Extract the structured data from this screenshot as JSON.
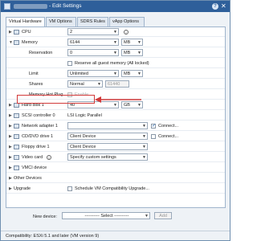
{
  "window": {
    "title": "- Edit Settings"
  },
  "tabs": [
    {
      "label": "Virtual Hardware"
    },
    {
      "label": "VM Options"
    },
    {
      "label": "SDRS Rules"
    },
    {
      "label": "vApp Options"
    }
  ],
  "rows": {
    "cpu": {
      "label": "CPU",
      "value": "2"
    },
    "memory": {
      "label": "Memory",
      "value": "6144",
      "unit": "MB"
    },
    "reservation": {
      "label": "Reservation",
      "value": "0",
      "unit": "MB"
    },
    "reserve_all": {
      "label": "Reserve all guest memory (All locked)"
    },
    "limit": {
      "label": "Limit",
      "value": "Unlimited",
      "unit": "MB"
    },
    "shares": {
      "label": "Shares",
      "value": "Normal",
      "extra": "61440"
    },
    "hotplug": {
      "label": "Memory Hot Plug",
      "checkbox_label": "Enable"
    },
    "hard_disk": {
      "label": "Hard disk 1",
      "value": "40",
      "unit": "GB"
    },
    "scsi": {
      "label": "SCSI controller 0",
      "value": "LSI Logic Parallel"
    },
    "network": {
      "label": "Network adapter 1",
      "connect": "Connect..."
    },
    "cd": {
      "label": "CD/DVD drive 1",
      "value": "Client Device",
      "connect": "Connect..."
    },
    "floppy": {
      "label": "Floppy drive 1",
      "value": "Client Device"
    },
    "video": {
      "label": "Video card",
      "value": "Specify custom settings"
    },
    "vmci": {
      "label": "VMCI device"
    },
    "other": {
      "label": "Other Devices"
    },
    "upgrade": {
      "label": "Upgrade",
      "checkbox_label": "Schedule VM Compatibility Upgrade..."
    }
  },
  "new_device": {
    "label": "New device:",
    "value": "---------- Select ----------",
    "add": "Add"
  },
  "status": {
    "text": "Compatibility: ESXi 5.1 and later (VM version 9)"
  }
}
